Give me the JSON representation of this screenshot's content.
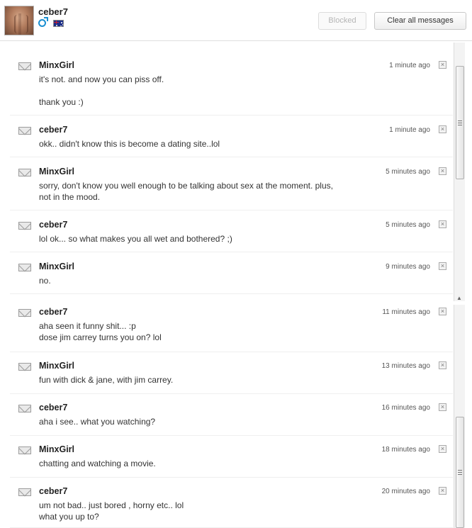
{
  "header": {
    "username": "ceber7",
    "blocked_label": "Blocked",
    "clear_label": "Clear all messages",
    "gender_icon": "male-icon",
    "flag_icon": "australia-flag-icon"
  },
  "messages": [
    {
      "sender": "MinxGirl",
      "time": "1 minute ago",
      "text": "it's not. and now you can piss off.\n\nthank you :)"
    },
    {
      "sender": "ceber7",
      "time": "1 minute ago",
      "text": "okk.. didn't know this is become a dating site..lol"
    },
    {
      "sender": "MinxGirl",
      "time": "5 minutes ago",
      "text": "sorry, don't know you well enough to be talking about sex at the moment. plus,\nnot in the mood."
    },
    {
      "sender": "ceber7",
      "time": "5 minutes ago",
      "text": "lol ok... so what makes you all wet and bothered? ;)"
    },
    {
      "sender": "MinxGirl",
      "time": "9 minutes ago",
      "text": "no."
    },
    {
      "sender": "ceber7",
      "time": "11 minutes ago",
      "text": "aha seen it funny shit... :p\ndose jim carrey turns you on? lol"
    },
    {
      "sender": "MinxGirl",
      "time": "13 minutes ago",
      "text": "fun with dick & jane, with jim carrey."
    },
    {
      "sender": "ceber7",
      "time": "16 minutes ago",
      "text": "aha i see.. what you watching?"
    },
    {
      "sender": "MinxGirl",
      "time": "18 minutes ago",
      "text": "chatting and watching a movie."
    },
    {
      "sender": "ceber7",
      "time": "20 minutes ago",
      "text": "um not bad.. just bored , horny etc.. lol\nwhat you up to?"
    }
  ],
  "icons": {
    "envelope": "envelope-icon",
    "delete": "close-icon"
  }
}
